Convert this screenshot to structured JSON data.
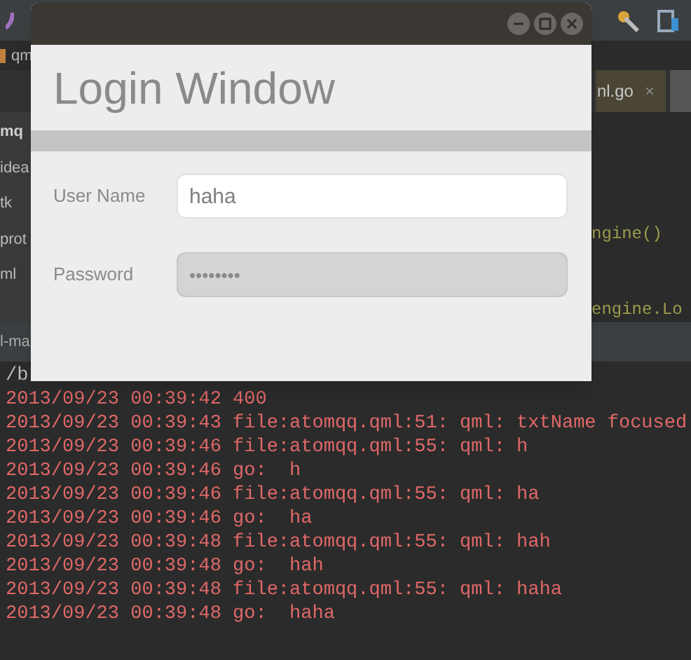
{
  "ide": {
    "file_tab": "qm",
    "sidebar": {
      "header": "mq",
      "items": [
        "idea",
        "tk",
        "prot",
        "ml"
      ]
    },
    "editor_tab": {
      "label": "nl.go",
      "close": "×"
    },
    "code_lines": [
      "ngine()",
      "engine.Lo"
    ],
    "panel_title": "l-ma",
    "console": {
      "path": "/b",
      "lines": [
        "2013/09/23 00:39:42 400",
        "2013/09/23 00:39:43 file:atomqq.qml:51: qml: txtName focused",
        "2013/09/23 00:39:46 file:atomqq.qml:55: qml: h",
        "2013/09/23 00:39:46 go:  h",
        "2013/09/23 00:39:46 file:atomqq.qml:55: qml: ha",
        "2013/09/23 00:39:46 go:  ha",
        "2013/09/23 00:39:48 file:atomqq.qml:55: qml: hah",
        "2013/09/23 00:39:48 go:  hah",
        "2013/09/23 00:39:48 file:atomqq.qml:55: qml: haha",
        "2013/09/23 00:39:48 go:  haha"
      ]
    }
  },
  "window": {
    "title": "Login Window",
    "fields": [
      {
        "label": "User Name",
        "value": "haha",
        "focused": true
      },
      {
        "label": "Password",
        "value": "••••••••",
        "focused": false
      }
    ]
  }
}
